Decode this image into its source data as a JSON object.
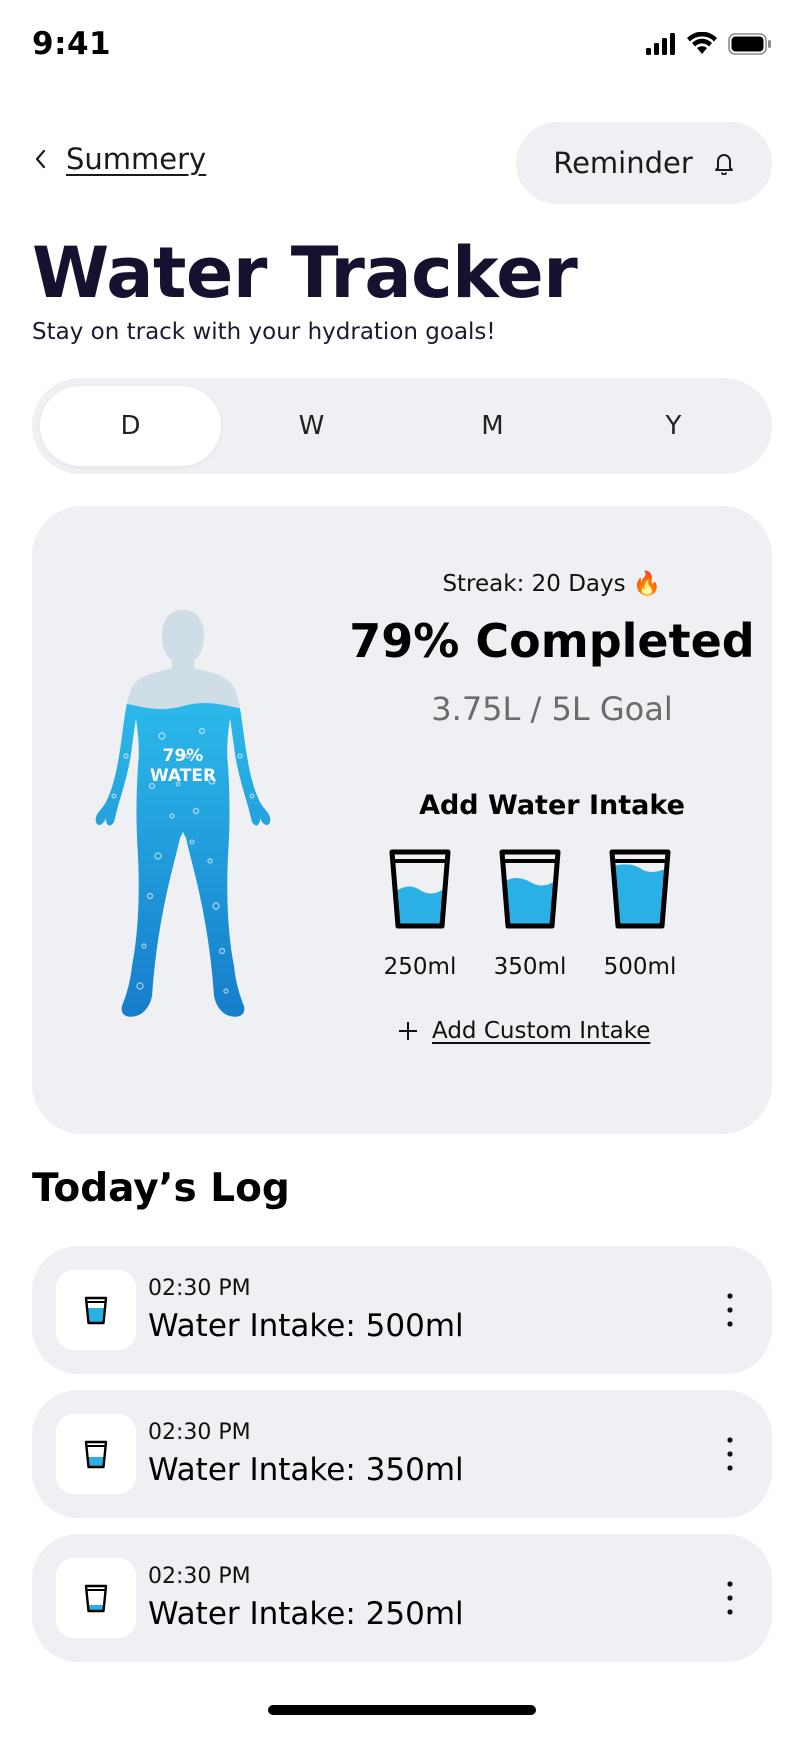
{
  "status_bar": {
    "time": "9:41"
  },
  "nav": {
    "back_label": "Summery",
    "reminder_label": "Reminder"
  },
  "header": {
    "title": "Water Tracker",
    "subtitle": "Stay on track with your hydration goals!"
  },
  "period_tabs": [
    {
      "label": "D",
      "active": true
    },
    {
      "label": "W",
      "active": false
    },
    {
      "label": "M",
      "active": false
    },
    {
      "label": "Y",
      "active": false
    }
  ],
  "summary": {
    "streak": "Streak: 20 Days 🔥",
    "completed": "79% Completed",
    "goal": "3.75L / 5L Goal",
    "body_percent": "79%",
    "body_label": "WATER",
    "fill_fraction": 0.79,
    "add_title": "Add Water Intake",
    "cups": [
      {
        "label": "250ml",
        "fill": 0.45
      },
      {
        "label": "350ml",
        "fill": 0.62
      },
      {
        "label": "500ml",
        "fill": 0.85
      }
    ],
    "custom_label": "Add Custom Intake"
  },
  "log": {
    "title": "Today’s Log",
    "items": [
      {
        "time": "02:30 PM",
        "amount": "Water Intake: 500ml",
        "fill": 0.6
      },
      {
        "time": "02:30 PM",
        "amount": "Water Intake: 350ml",
        "fill": 0.4
      },
      {
        "time": "02:30 PM",
        "amount": "Water Intake: 250ml",
        "fill": 0.25
      }
    ]
  },
  "colors": {
    "accent_water": "#2ab0e4",
    "card_bg": "#eff0f3",
    "title_navy": "#14122e"
  },
  "icons": [
    "chevron-left-icon",
    "bell-icon",
    "plus-icon",
    "cup-icon",
    "more-vertical-icon",
    "signal-icon",
    "wifi-icon",
    "battery-icon"
  ]
}
